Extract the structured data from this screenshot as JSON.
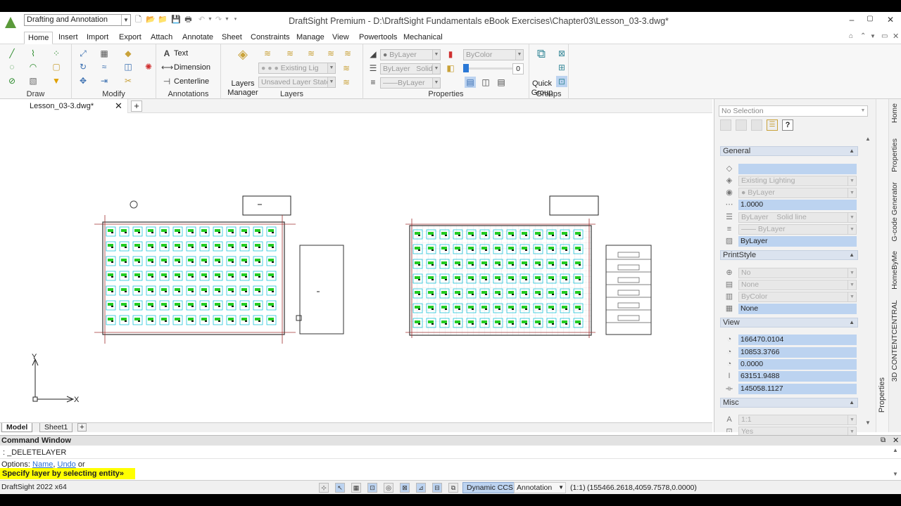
{
  "window": {
    "title": "DraftSight Premium - D:\\DraftSight Fundamentals eBook Exercises\\Chapter03\\Lesson_03-3.dwg*",
    "workspace": "Drafting and Annotation"
  },
  "menu_tabs": [
    "Home",
    "Insert",
    "Import",
    "Export",
    "Attach",
    "Annotate",
    "Sheet",
    "Constraints",
    "Manage",
    "View",
    "Powertools",
    "Mechanical"
  ],
  "ribbon": {
    "draw": {
      "label": "Draw"
    },
    "modify": {
      "label": "Modify"
    },
    "annotations": {
      "label": "Annotations",
      "text": "Text",
      "dimension": "Dimension",
      "centerline": "Centerline"
    },
    "layers": {
      "label": "Layers",
      "manager_line1": "Layers",
      "manager_line2": "Manager",
      "current_layer": "Existing Lig",
      "layer_state": "Unsaved Layer State"
    },
    "properties": {
      "label": "Properties",
      "color": "ByLayer",
      "linestyle_a": "ByLayer",
      "linestyle_b": "Solid",
      "lineweight": "ByLayer",
      "printstyle": "ByColor",
      "transparency": "0"
    },
    "groups": {
      "label": "Groups",
      "quick_line1": "Quick",
      "quick_line2": "Group"
    }
  },
  "doc_tab": {
    "name": "Lesson_03-3.dwg*"
  },
  "sheet_tabs": [
    "Model",
    "Sheet1"
  ],
  "axis": {
    "x": "X",
    "y": "Y"
  },
  "properties_panel": {
    "selection": "No Selection",
    "general": {
      "title": "General",
      "color": "",
      "layer": "Existing Lighting",
      "linecolor": "ByLayer",
      "linescale": "1.0000",
      "linestyle_a": "ByLayer",
      "linestyle_b": "Solid line",
      "lineweight": "ByLayer",
      "transparency": "ByLayer"
    },
    "printstyle": {
      "title": "PrintStyle",
      "a": "No",
      "b": "None",
      "c": "ByColor",
      "d": "None"
    },
    "view": {
      "title": "View",
      "center_x": "166470.0104",
      "center_y": "10853.3766",
      "center_z": "0.0000",
      "height": "63151.9488",
      "width": "145058.1127"
    },
    "misc": {
      "title": "Misc",
      "scale": "1:1",
      "flag": "Yes"
    }
  },
  "right_tabs": [
    "Home",
    "Properties",
    "G-code Generator",
    "HomeByMe",
    "3D CONTENTCENTRAL"
  ],
  "panel_side_label": "Properties",
  "command": {
    "header": "Command Window",
    "line1": ": _DELETELAYER",
    "options_prefix": "Options: ",
    "option_name": "Name",
    "option_sep": ", ",
    "option_undo": "Undo",
    "options_suffix": " or",
    "prompt": "Specify layer by selecting entity»"
  },
  "status": {
    "app": "DraftSight 2022 x64",
    "dynamic_ccs": "Dynamic CCS",
    "annotation": "Annotation",
    "scale": "(1:1)",
    "coords": "(155466.2618,4059.7578,0.0000)"
  },
  "colors": {
    "accent_blue": "#bcd3f0",
    "cyan": "#00bcd4",
    "green": "#22cc22",
    "prompt_yellow": "#ffff00"
  }
}
